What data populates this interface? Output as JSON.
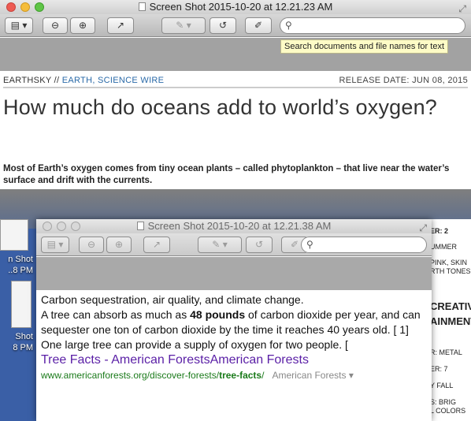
{
  "window_front": {
    "title": "Screen Shot 2015-10-20 at 12.21.23 AM",
    "toolbar": {
      "sidebar_icon": "▤",
      "dropdown_icon": "▾",
      "zoom_out_icon": "⊖",
      "zoom_in_icon": "⊕",
      "share_icon": "↗",
      "annotate_icon": "✎",
      "rotate_icon": "↺",
      "edit_icon": "✐",
      "search_icon": "⚲",
      "search_placeholder": ""
    },
    "tooltip": "Search documents and file names for text",
    "article": {
      "site": "EARTHSKY",
      "separator": "//",
      "categories": "EARTH, SCIENCE WIRE",
      "release": "RELEASE DATE: JUN 08, 2015",
      "title": "How much do oceans add to world’s oxygen?",
      "lede": "Most of Earth’s oxygen comes from tiny ocean plants – called phytoplankton – that live near the water’s surface and drift with the currents."
    }
  },
  "window_back": {
    "title": "Screen Shot 2015-10-20 at 12.21.38 AM",
    "content": {
      "line1": "Carbon sequestration, air quality, and climate change.",
      "line2_pre": "A tree can absorb as much as ",
      "line2_bold": "48 pounds",
      "line2_post": " of carbon dioxide per year, and can sequester one ton of carbon dioxide by the time it reaches 40 years old. [ 1]",
      "line3": "One large tree can provide a supply of oxygen for two people. [",
      "link_title": "Tree Facts - American ForestsAmerican Forests",
      "cite_url_pre": "www.americanforests.org/discover-forests/",
      "cite_url_bold": "tree-facts",
      "cite_url_post": "/",
      "cite_source": "American Forests ▾"
    }
  },
  "desktop": {
    "left_labels": [
      "n Shot",
      "..8 PM",
      "Shot",
      "8 PM"
    ],
    "right_snippets": [
      "ER: 2",
      "UMMER",
      "PINK, SKIN",
      "RTH TONES",
      "CREATIV",
      "AINMENT",
      "R: METAL",
      "ER: 7",
      "Y FALL",
      "S: BRIG",
      "L COLORS"
    ]
  }
}
